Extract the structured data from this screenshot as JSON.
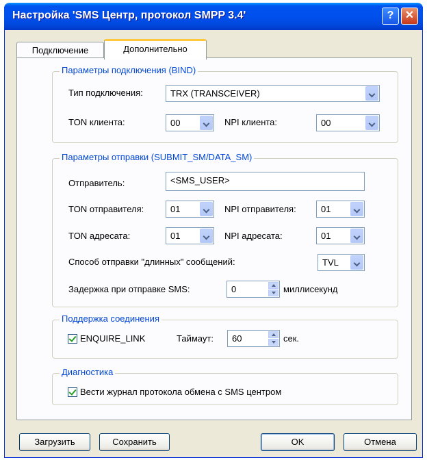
{
  "window": {
    "title": "Настройка 'SMS Центр, протокол SMPP 3.4'",
    "help_label": "?",
    "close_label": "✕"
  },
  "tabs": [
    {
      "label": "Подключение"
    },
    {
      "label": "Дополнительно"
    }
  ],
  "bind": {
    "legend": "Параметры подключения (BIND)",
    "type_label": "Тип подключения:",
    "type_value": "TRX (TRANSCEIVER)",
    "ton_client_label": "TON клиента:",
    "ton_client_value": "00",
    "npi_client_label": "NPI клиента:",
    "npi_client_value": "00"
  },
  "submit": {
    "legend": "Параметры отправки (SUBMIT_SM/DATA_SM)",
    "sender_label": "Отправитель:",
    "sender_value": "<SMS_USER>",
    "ton_sender_label": "TON отправителя:",
    "ton_sender_value": "01",
    "npi_sender_label": "NPI отправителя:",
    "npi_sender_value": "01",
    "ton_dest_label": "TON адресата:",
    "ton_dest_value": "01",
    "npi_dest_label": "NPI адресата:",
    "npi_dest_value": "01",
    "long_label": "Способ отправки \"длинных\" сообщений:",
    "long_value": "TVL",
    "delay_label": "Задержка при отправке SMS:",
    "delay_value": "0",
    "delay_unit": "миллисекунд"
  },
  "keepalive": {
    "legend": "Поддержка соединения",
    "enquire_label": "ENQUIRE_LINK",
    "timeout_label": "Таймаут:",
    "timeout_value": "60",
    "timeout_unit": "сек."
  },
  "diag": {
    "legend": "Диагностика",
    "log_label": "Вести журнал протокола обмена с SMS центром"
  },
  "buttons": {
    "load": "Загрузить",
    "save": "Сохранить",
    "ok": "OK",
    "cancel": "Отмена"
  },
  "colors": {
    "titlebar": "#0053ee",
    "legend": "#0046d5",
    "tab_highlight": "#ffc83c"
  }
}
